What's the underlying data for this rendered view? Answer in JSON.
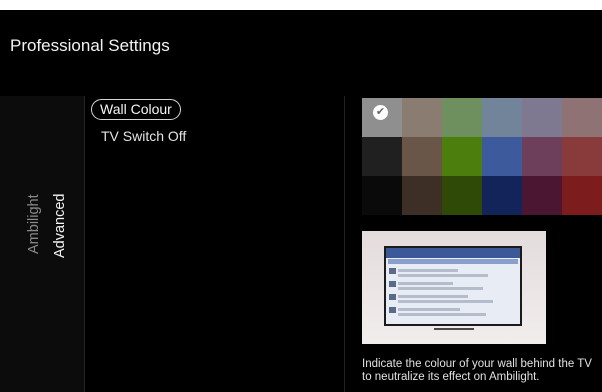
{
  "header": {
    "title": "Professional Settings"
  },
  "tabs": [
    {
      "label": "Ambilight",
      "selected": false
    },
    {
      "label": "Advanced",
      "selected": true
    }
  ],
  "menu": {
    "items": [
      {
        "label": "Wall Colour",
        "selected": true
      },
      {
        "label": "TV Switch Off",
        "selected": false
      }
    ]
  },
  "wall_colour": {
    "swatches": [
      "#8f8f8f",
      "#8b7c72",
      "#6e8f5e",
      "#72849a",
      "#7e7891",
      "#8f7273",
      "#202020",
      "#695648",
      "#4c7e0e",
      "#3d5a9c",
      "#6d3f5a",
      "#893a3b",
      "#0a0a0a",
      "#3d2f25",
      "#2f4a06",
      "#13245a",
      "#4a1632",
      "#7d1c1c"
    ],
    "selected_swatch": "#8f8f8f",
    "check_icon": "checkmark-icon",
    "description": "Indicate the colour of your wall behind the TV to neutralize its effect on Ambilight."
  },
  "colors": {
    "background": "#000000",
    "accent_outline": "#d7d7d7"
  }
}
